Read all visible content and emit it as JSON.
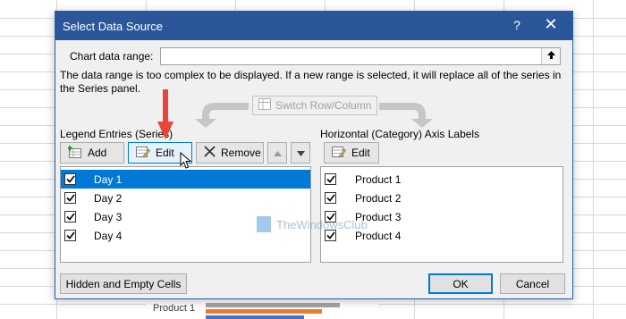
{
  "dialog": {
    "title": "Select Data Source",
    "help_glyph": "?",
    "close_glyph": "✕"
  },
  "range": {
    "label": "Chart data range:",
    "value": "",
    "message": "The data range is too complex to be displayed. If a new range is selected, it will replace all of the series in the Series panel."
  },
  "switch_button": {
    "label": "Switch Row/Column"
  },
  "legend": {
    "group_label": "Legend Entries (Series)",
    "add_label": "Add",
    "edit_label": "Edit",
    "remove_label": "Remove",
    "items": [
      {
        "label": "Day 1",
        "checked": true,
        "selected": true
      },
      {
        "label": "Day 2",
        "checked": true,
        "selected": false
      },
      {
        "label": "Day 3",
        "checked": true,
        "selected": false
      },
      {
        "label": "Day 4",
        "checked": true,
        "selected": false
      }
    ]
  },
  "axis": {
    "group_label": "Horizontal (Category) Axis Labels",
    "edit_label": "Edit",
    "items": [
      {
        "label": "Product 1",
        "checked": true
      },
      {
        "label": "Product 2",
        "checked": true
      },
      {
        "label": "Product 3",
        "checked": true
      },
      {
        "label": "Product 4",
        "checked": true
      }
    ]
  },
  "bottom": {
    "hidden_cells_label": "Hidden and Empty Cells",
    "ok_label": "OK",
    "cancel_label": "Cancel"
  },
  "background": {
    "chart_label": "Product 1"
  },
  "watermark": {
    "text": "TheWindowsClub"
  },
  "colors": {
    "title_bar": "#2b579a",
    "selection": "#0078d7",
    "annotation_arrow": "#e8463a",
    "bar_gray": "#a5a5a5",
    "bar_orange": "#ed7d31",
    "bar_blue": "#4472c4"
  }
}
